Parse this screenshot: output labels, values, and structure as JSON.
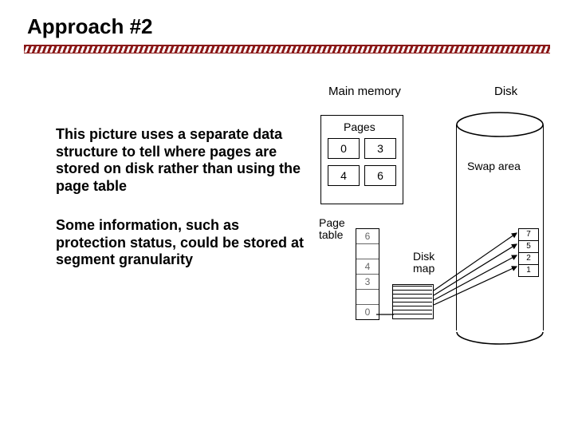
{
  "title": "Approach #2",
  "paragraphs": {
    "p1": "This picture uses a separate data structure to tell where pages are stored on disk rather than using the page table",
    "p2": "Some information, such as protection status, could be stored at segment granularity"
  },
  "diagram": {
    "main_memory_label": "Main memory",
    "pages_label": "Pages",
    "page_frames": [
      "0",
      "3",
      "4",
      "6"
    ],
    "page_table_label": "Page\ntable",
    "page_table_entries": [
      "6",
      "",
      "4",
      "3",
      "",
      "0"
    ],
    "disk_map_label": "Disk\nmap",
    "disk_label": "Disk",
    "swap_area_label": "Swap area",
    "swap_slots": [
      "7",
      "5",
      "2",
      "1"
    ]
  }
}
